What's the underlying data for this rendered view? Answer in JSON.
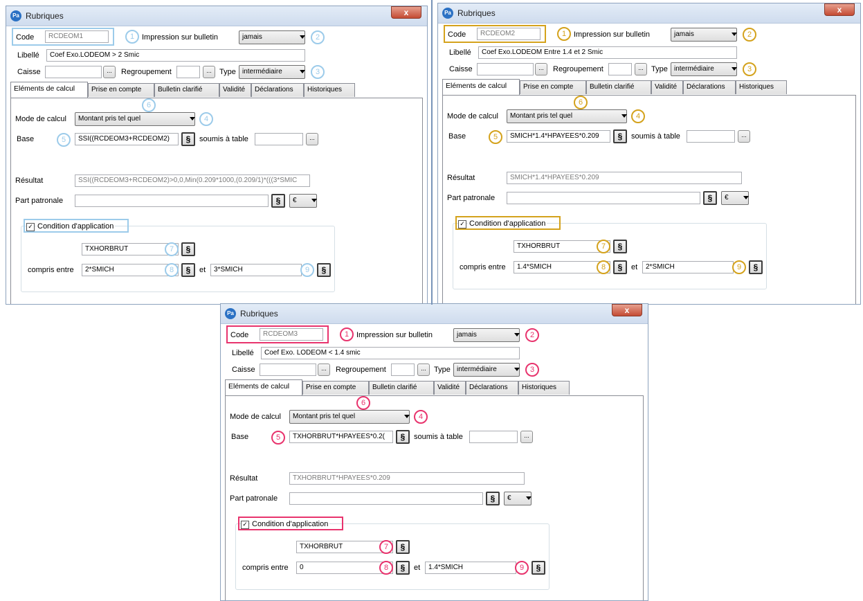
{
  "window_title": "Rubriques",
  "app_icon": "Pa",
  "close_glyph": "x",
  "labels": {
    "code": "Code",
    "impression": "Impression sur bulletin",
    "libelle": "Libellé",
    "caisse": "Caisse",
    "regroupement": "Regroupement",
    "type": "Type",
    "mode_calcul": "Mode de calcul",
    "base": "Base",
    "soumis": "soumis à table",
    "resultat": "Résultat",
    "part_patronale": "Part patronale",
    "condition": "Condition d'application",
    "compris": "compris entre",
    "et": "et",
    "dots": "...",
    "section_sign": "§",
    "check": "✓"
  },
  "tabs": [
    "Eléments de calcul",
    "Prise en compte",
    "Bulletin clarifié",
    "Validité",
    "Déclarations",
    "Historiques"
  ],
  "callouts": [
    "1",
    "2",
    "3",
    "4",
    "5",
    "6",
    "7",
    "8",
    "9"
  ],
  "windows": [
    {
      "code": "RCDEOM1",
      "impression": "jamais",
      "libelle": "Coef Exo.LODEOM > 2 Smic",
      "caisse": "",
      "regroupement": "",
      "type": "intermédiaire",
      "mode": "Montant pris tel quel",
      "base": "SSI((RCDEOM3+RCDEOM2)",
      "soumis": "",
      "resultat": "SSI((RCDEOM3+RCDEOM2)>0,0,Min(0.209*1000,(0.209/1)*(((3*SMIC",
      "part_patronale": "",
      "currency": "€",
      "condition_checked": true,
      "condition_var": "TXHORBRUT",
      "min": "2*SMICH",
      "max": "3*SMICH",
      "accent": "#9ccbea"
    },
    {
      "code": "RCDEOM2",
      "impression": "jamais",
      "libelle": "Coef Exo.LODEOM Entre 1.4 et 2 Smic",
      "caisse": "",
      "regroupement": "",
      "type": "intermédiaire",
      "mode": "Montant pris tel quel",
      "base": "SMICH*1.4*HPAYEES*0.209",
      "soumis": "",
      "resultat": "SMICH*1.4*HPAYEES*0.209",
      "part_patronale": "",
      "currency": "€",
      "condition_checked": true,
      "condition_var": "TXHORBRUT",
      "min": "1.4*SMICH",
      "max": "2*SMICH",
      "accent": "#d4a21c"
    },
    {
      "code": "RCDEOM3",
      "impression": "jamais",
      "libelle": "Coef Exo. LODEOM < 1.4 smic",
      "caisse": "",
      "regroupement": "",
      "type": "intermédiaire",
      "mode": "Montant pris tel quel",
      "base": "TXHORBRUT*HPAYEES*0.2(",
      "soumis": "",
      "resultat": "TXHORBRUT*HPAYEES*0.209",
      "part_patronale": "",
      "currency": "€",
      "condition_checked": true,
      "condition_var": "TXHORBRUT",
      "min": "0",
      "max": "1.4*SMICH",
      "accent": "#e8336d"
    }
  ]
}
